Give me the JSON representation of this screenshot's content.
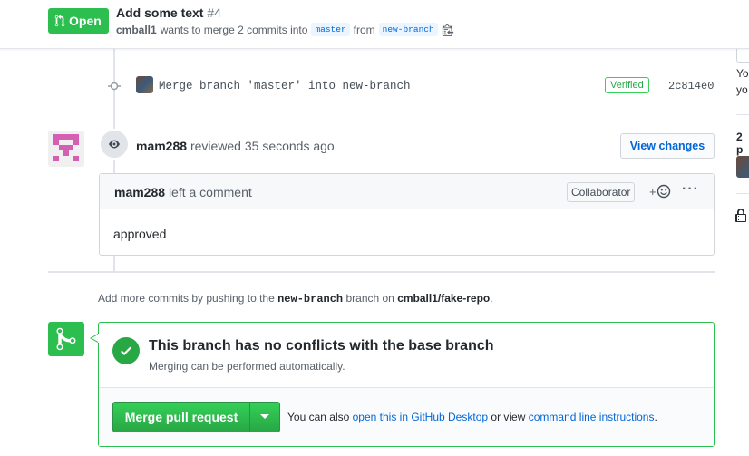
{
  "header": {
    "state": "Open",
    "title": "Add some text",
    "number": "#4",
    "author": "cmball1",
    "merge_text": "wants to merge 2 commits into",
    "base_branch": "master",
    "from_text": "from",
    "head_branch": "new-branch"
  },
  "timeline": {
    "commit": {
      "message": "Merge branch 'master' into new-branch",
      "verified": "Verified",
      "sha": "2c814e0"
    },
    "review": {
      "reviewer": "mam288",
      "action": "reviewed",
      "time": "35 seconds ago",
      "view_changes": "View changes"
    },
    "comment": {
      "author": "mam288",
      "action": "left a comment",
      "role": "Collaborator",
      "reaction": "+",
      "menu": "···",
      "body": "approved"
    }
  },
  "add_commits": {
    "prefix": "Add more commits by pushing to the",
    "branch": "new-branch",
    "middle": "branch on",
    "repo": "cmball1/fake-repo",
    "suffix": "."
  },
  "merge": {
    "status_title": "This branch has no conflicts with the base branch",
    "status_subtitle": "Merging can be performed automatically.",
    "button": "Merge pull request",
    "also_prefix": "You can also",
    "desktop_link": "open this in GitHub Desktop",
    "or_view": "or view",
    "cli_link": "command line instructions",
    "suffix": "."
  },
  "sidebar": {
    "text1": "Yo",
    "text2": "yo",
    "text3": "2 p"
  },
  "colors": {
    "green": "#2cbe4e",
    "link": "#0366d6",
    "identicon": "#d55fb3"
  },
  "icons": [
    "git-pull-request-icon",
    "clipboard-icon",
    "commit-icon",
    "eye-icon",
    "smiley-icon",
    "kebab-icon",
    "git-merge-icon",
    "check-icon",
    "caret-down-icon",
    "lock-icon"
  ]
}
